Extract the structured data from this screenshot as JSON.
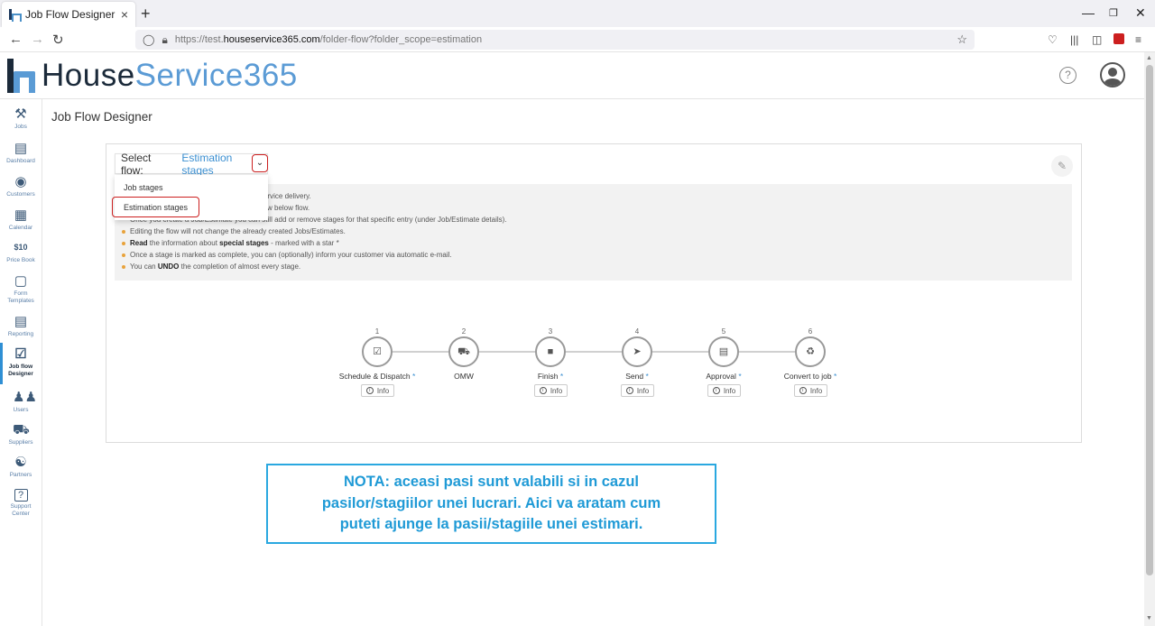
{
  "browser": {
    "tab_title": "Job Flow Designer",
    "tab_close": "×",
    "new_tab": "+",
    "url_prefix": "https://test.",
    "url_domain": "houseservice365.com",
    "url_path": "/folder-flow?folder_scope=estimation"
  },
  "app": {
    "logo_part1": "House",
    "logo_part2": "Service365",
    "help_label": "?",
    "page_title": "Job Flow Designer"
  },
  "sidebar": {
    "items": [
      {
        "label": "Jobs",
        "icon": "tools-icon"
      },
      {
        "label": "Dashboard",
        "icon": "bar-chart-icon"
      },
      {
        "label": "Customers",
        "icon": "target-icon"
      },
      {
        "label": "Calendar",
        "icon": "calendar-icon"
      },
      {
        "label": "Price Book",
        "icon": "price-tag-icon"
      },
      {
        "label": "Form Templates",
        "icon": "form-icon"
      },
      {
        "label": "Reporting",
        "icon": "report-icon"
      },
      {
        "label": "Job flow Designer",
        "icon": "flow-icon"
      },
      {
        "label": "Users",
        "icon": "users-icon"
      },
      {
        "label": "Suppliers",
        "icon": "truck-icon"
      },
      {
        "label": "Partners",
        "icon": "partners-icon"
      },
      {
        "label": "Support Center",
        "icon": "help-icon"
      }
    ],
    "active_index": 7
  },
  "flow_select": {
    "label": "Select flow:",
    "value": "Estimation stages",
    "options": [
      "Job stages",
      "Estimation stages"
    ],
    "selected_option": "Estimation stages"
  },
  "info": {
    "line1": "service delivery.",
    "line2": "llow below flow.",
    "line3": "Once you create a Job/Estimate you can still add or remove stages for that specific entry (under Job/Estimate details).",
    "line4": "Editing the flow will not change the already created Jobs/Estimates.",
    "line5_bold1": "Read",
    "line5_mid": " the information about ",
    "line5_bold2": "special stages",
    "line5_end": " - marked with a star *",
    "line6": "Once a stage is marked as complete, you can (optionally) inform your customer via automatic e-mail.",
    "line7_start": "You can ",
    "line7_bold": "UNDO",
    "line7_end": " the completion of almost every stage."
  },
  "stages": [
    {
      "num": "1",
      "name": "Schedule & Dispatch",
      "star": "*",
      "icon": "calendar-check-icon",
      "info": "Info"
    },
    {
      "num": "2",
      "name": "OMW",
      "star": "",
      "icon": "truck-icon",
      "info": ""
    },
    {
      "num": "3",
      "name": "Finish",
      "star": "*",
      "icon": "stop-icon",
      "info": "Info"
    },
    {
      "num": "4",
      "name": "Send",
      "star": "*",
      "icon": "paper-plane-icon",
      "info": "Info"
    },
    {
      "num": "5",
      "name": "Approval",
      "star": "*",
      "icon": "document-icon",
      "info": "Info"
    },
    {
      "num": "6",
      "name": "Convert to job",
      "star": "*",
      "icon": "recycle-icon",
      "info": "Info"
    }
  ],
  "note": {
    "line1": "NOTA: aceasi pasi sunt valabili si in cazul",
    "line2": "pasilor/stagiilor  unei lucrari. Aici va aratam cum",
    "line3": "puteti ajunge la pasii/stagiile  unei estimari."
  }
}
